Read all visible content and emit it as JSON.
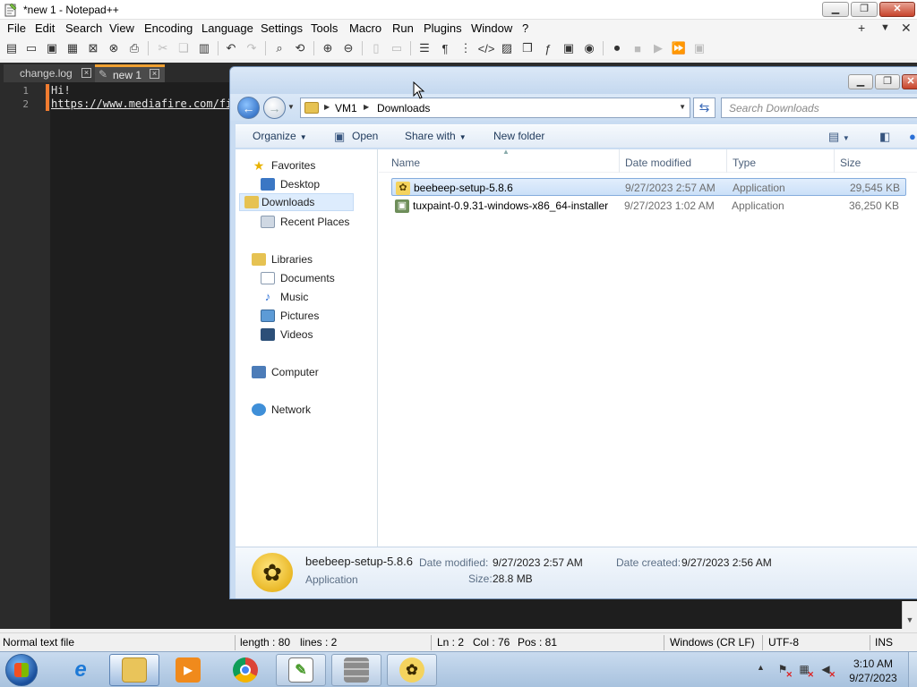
{
  "npp": {
    "title": "*new 1 - Notepad++",
    "menu": [
      "File",
      "Edit",
      "Search",
      "View",
      "Encoding",
      "Language",
      "Settings",
      "Tools",
      "Macro",
      "Run",
      "Plugins",
      "Window",
      "?"
    ],
    "menu_right": [
      "+",
      "▼",
      "✕"
    ],
    "tabs": [
      {
        "label": "change.log",
        "active": false
      },
      {
        "label": "new 1",
        "active": true
      }
    ],
    "lines": [
      {
        "no": "1",
        "text": "Hi!"
      },
      {
        "no": "2",
        "text": "https://www.mediafire.com/fi"
      }
    ],
    "status": {
      "lang": "Normal text file",
      "length": "length : 80",
      "lines": "lines : 2",
      "ln": "Ln : 2",
      "col": "Col : 76",
      "pos": "Pos : 81",
      "eol": "Windows (CR LF)",
      "encoding": "UTF-8",
      "mode": "INS"
    }
  },
  "explorer": {
    "breadcrumb": [
      "VM1",
      "Downloads"
    ],
    "search_placeholder": "Search Downloads",
    "commands": {
      "organize": "Organize",
      "open": "Open",
      "share_with": "Share with",
      "new_folder": "New folder"
    },
    "nav": {
      "favorites": "Favorites",
      "desktop": "Desktop",
      "downloads": "Downloads",
      "recent_places": "Recent Places",
      "libraries": "Libraries",
      "documents": "Documents",
      "music": "Music",
      "pictures": "Pictures",
      "videos": "Videos",
      "computer": "Computer",
      "network": "Network"
    },
    "columns": {
      "name": "Name",
      "date_modified": "Date modified",
      "type": "Type",
      "size": "Size"
    },
    "files": [
      {
        "name": "beebeep-setup-5.8.6",
        "date": "9/27/2023 2:57 AM",
        "type": "Application",
        "size": "29,545 KB",
        "selected": true
      },
      {
        "name": "tuxpaint-0.9.31-windows-x86_64-installer",
        "date": "9/27/2023 1:02 AM",
        "type": "Application",
        "size": "36,250 KB",
        "selected": false
      }
    ],
    "details": {
      "name": "beebeep-setup-5.8.6",
      "kind": "Application",
      "date_modified_label": "Date modified:",
      "date_modified": "9/27/2023 2:57 AM",
      "size_label": "Size:",
      "size": "28.8 MB",
      "date_created_label": "Date created:",
      "date_created": "9/27/2023 2:56 AM"
    }
  },
  "taskbar": {
    "clock_time": "3:10 AM",
    "clock_date": "9/27/2023"
  }
}
